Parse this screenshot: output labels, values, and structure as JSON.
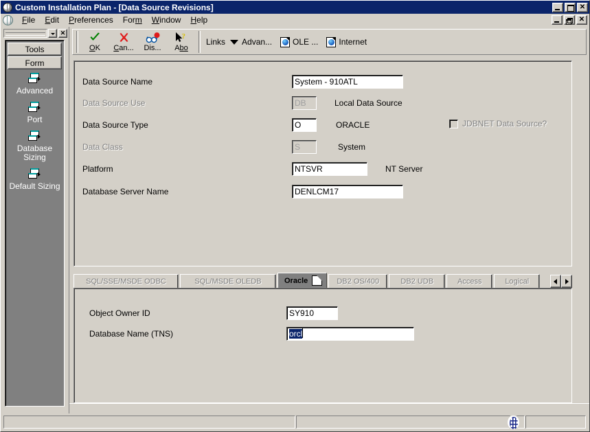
{
  "window": {
    "title": "Custom Installation Plan - [Data Source Revisions]",
    "icon": "globe-icon",
    "controls": {
      "minimize": "_",
      "maximize": "□",
      "restore": "❐",
      "close": "✕"
    }
  },
  "menubar": {
    "icon": "globe-icon",
    "items": [
      {
        "label": "File",
        "accel": "F"
      },
      {
        "label": "Edit",
        "accel": "E"
      },
      {
        "label": "Preferences",
        "accel": "P"
      },
      {
        "label": "Form",
        "accel": "m"
      },
      {
        "label": "Window",
        "accel": "W"
      },
      {
        "label": "Help",
        "accel": "H"
      }
    ]
  },
  "sidebar": {
    "close_label": "✕",
    "buttons": [
      {
        "label": "Tools"
      },
      {
        "label": "Form"
      }
    ],
    "items": [
      {
        "label": "Advanced",
        "icon": "form-icon"
      },
      {
        "label": "Port",
        "icon": "form-icon"
      },
      {
        "label": "Database Sizing",
        "icon": "form-icon"
      },
      {
        "label": "Default Sizing",
        "icon": "form-icon"
      }
    ]
  },
  "toolbar": {
    "buttons": [
      {
        "label": "OK",
        "accel": "O",
        "rest": "K",
        "icon": "check-icon"
      },
      {
        "label": "Can...",
        "accel": "C",
        "rest": "an...",
        "icon": "x-icon"
      },
      {
        "label": "Dis...",
        "accel": "",
        "rest": "Dis...",
        "icon": "glasses-icon"
      },
      {
        "label": "Abo",
        "accel": "bo",
        "rest": "A",
        "icon": "help-cursor-icon"
      }
    ],
    "links_label": "Links",
    "links": [
      {
        "label": "Advan...",
        "icon": "chevron-down-icon"
      },
      {
        "label": "OLE ...",
        "icon": "globe-doc-icon"
      },
      {
        "label": "Internet",
        "icon": "globe-doc-icon"
      }
    ]
  },
  "form": {
    "fields": [
      {
        "label": "Data Source Name",
        "value": "System - 910ATL",
        "desc": "",
        "disabled": false
      },
      {
        "label": "Data Source Use",
        "value": "DB",
        "desc": "Local Data Source",
        "disabled": true
      },
      {
        "label": "Data Source Type",
        "value": "O",
        "desc": "ORACLE",
        "disabled": false
      },
      {
        "label": "Data Class",
        "value": "S",
        "desc": "System",
        "disabled": true
      },
      {
        "label": "Platform",
        "value": "NTSVR",
        "desc": "NT Server",
        "disabled": false
      },
      {
        "label": "Database Server Name",
        "value": "DENLCM17",
        "desc": "",
        "disabled": false
      }
    ],
    "checkbox": {
      "label": "JDBNET Data Source?",
      "checked": false,
      "disabled": true
    }
  },
  "tabs": {
    "items": [
      {
        "label": "SQL/SSE/MSDE ODBC",
        "active": false
      },
      {
        "label": "SQL/MSDE OLEDB",
        "active": false
      },
      {
        "label": "Oracle",
        "active": true
      },
      {
        "label": "DB2 OS/400",
        "active": false
      },
      {
        "label": "DB2 UDB",
        "active": false
      },
      {
        "label": "Access",
        "active": false
      },
      {
        "label": "Logical",
        "active": false
      }
    ],
    "nav_prev": "◀",
    "nav_next": "▶"
  },
  "tab_content": {
    "fields": [
      {
        "label": "Object Owner ID",
        "value": "SY910",
        "selected": false
      },
      {
        "label": "Database Name (TNS)",
        "value": "orcl",
        "selected": true
      }
    ]
  },
  "statusbar": {
    "cell1": "",
    "cell2": "",
    "cell3": "",
    "icon": "globe-icon"
  }
}
